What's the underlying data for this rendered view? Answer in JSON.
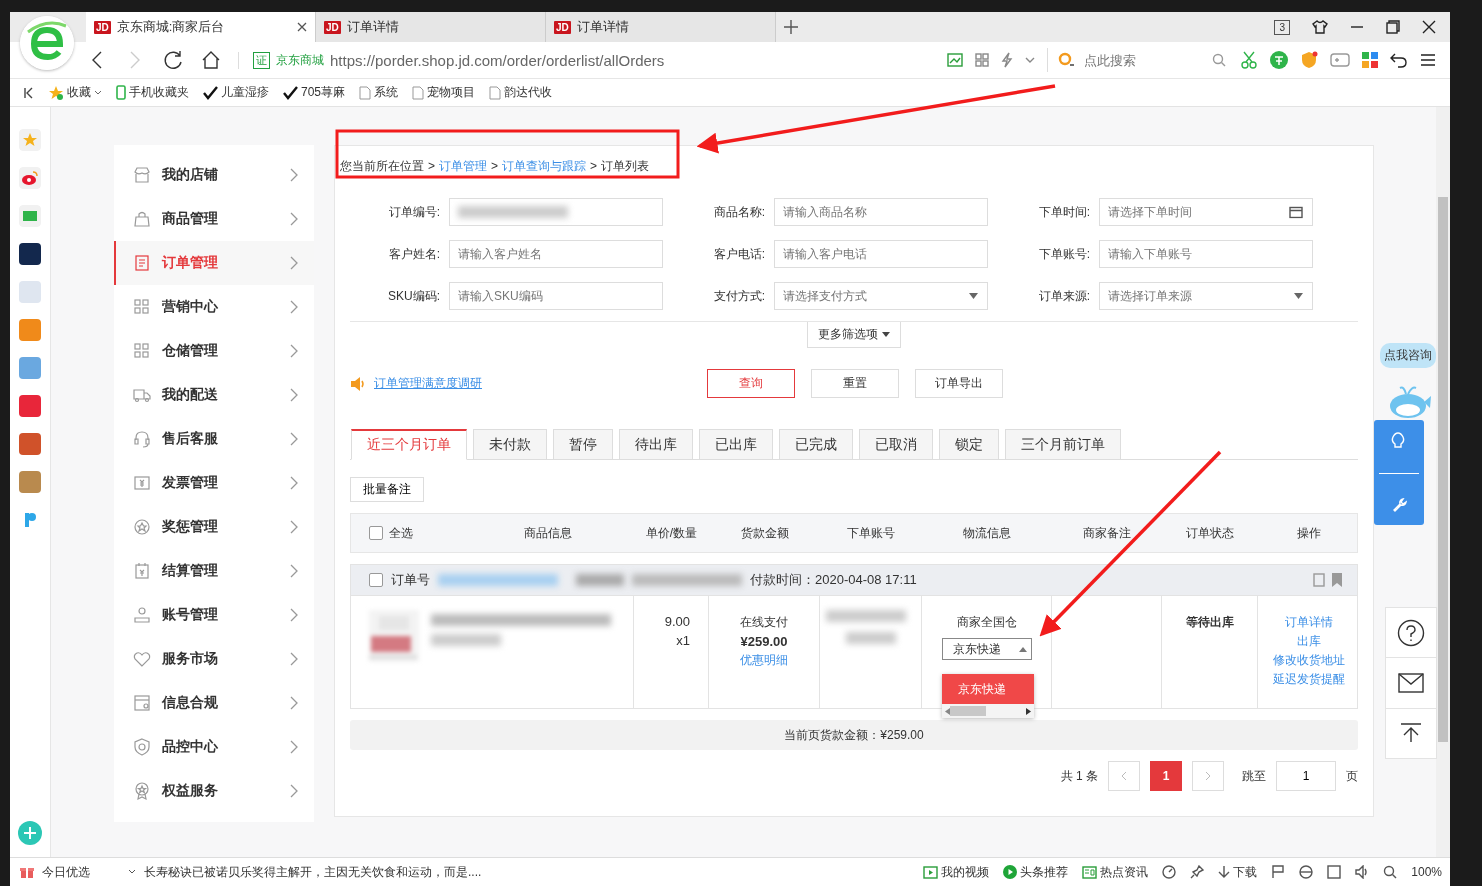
{
  "browser": {
    "tabs": [
      {
        "badge": "JD",
        "title": "京东商城:商家后台",
        "selected": true
      },
      {
        "badge": "JD",
        "title": "订单详情",
        "selected": false
      },
      {
        "badge": "JD",
        "title": "订单详情",
        "selected": false
      }
    ],
    "tab_count": "3",
    "cert_badge": "证",
    "site_name": "京东商城",
    "url_host": "https://porder.shop.jd.com",
    "url_path": "/order/orderlist/allOrders",
    "search_placeholder": "点此搜索",
    "bookmarks": [
      {
        "kind": "star",
        "label": "收藏"
      },
      {
        "kind": "phone",
        "label": "手机收藏夹"
      },
      {
        "kind": "check",
        "label": "儿童湿疹"
      },
      {
        "kind": "check",
        "label": "705荨麻"
      },
      {
        "kind": "page",
        "label": "系统"
      },
      {
        "kind": "page",
        "label": "宠物项目"
      },
      {
        "kind": "page",
        "label": "韵达代收"
      }
    ]
  },
  "sidebar_menu": [
    {
      "label": "我的店铺",
      "selected": false
    },
    {
      "label": "商品管理",
      "selected": false
    },
    {
      "label": "订单管理",
      "selected": true
    },
    {
      "label": "营销中心",
      "selected": false
    },
    {
      "label": "仓储管理",
      "selected": false
    },
    {
      "label": "我的配送",
      "selected": false
    },
    {
      "label": "售后客服",
      "selected": false
    },
    {
      "label": "发票管理",
      "selected": false
    },
    {
      "label": "奖惩管理",
      "selected": false
    },
    {
      "label": "结算管理",
      "selected": false
    },
    {
      "label": "账号管理",
      "selected": false
    },
    {
      "label": "服务市场",
      "selected": false
    },
    {
      "label": "信息合规",
      "selected": false
    },
    {
      "label": "品控中心",
      "selected": false
    },
    {
      "label": "权益服务",
      "selected": false
    }
  ],
  "breadcrumb": [
    {
      "label": "您当前所在位置",
      "link": false
    },
    {
      "separator": ">",
      "label": "订单管理",
      "link": true
    },
    {
      "separator": ">",
      "label": "订单查询与跟踪",
      "link": true
    },
    {
      "separator": ">",
      "label": "订单列表",
      "link": false
    }
  ],
  "filters": [
    {
      "label": "订单编号:",
      "kind": "redacted"
    },
    {
      "label": "商品名称:",
      "kind": "text",
      "placeholder": "请输入商品名称"
    },
    {
      "label": "下单时间:",
      "kind": "date",
      "placeholder": "请选择下单时间"
    },
    {
      "label": "客户姓名:",
      "kind": "text",
      "placeholder": "请输入客户姓名"
    },
    {
      "label": "客户电话:",
      "kind": "text",
      "placeholder": "请输入客户电话"
    },
    {
      "label": "下单账号:",
      "kind": "text",
      "placeholder": "请输入下单账号"
    },
    {
      "label": "SKU编码:",
      "kind": "text",
      "placeholder": "请输入SKU编码"
    },
    {
      "label": "支付方式:",
      "kind": "select",
      "placeholder": "请选择支付方式"
    },
    {
      "label": "订单来源:",
      "kind": "select",
      "placeholder": "请选择订单来源"
    }
  ],
  "more_filters": "更多筛选项",
  "survey_link": "订单管理满意度调研",
  "actions": [
    {
      "label": "查询",
      "kind": "primary"
    },
    {
      "label": "重置",
      "kind": "default"
    },
    {
      "label": "订单导出",
      "kind": "default"
    }
  ],
  "status_tabs": [
    {
      "label": "近三个月订单",
      "selected": true
    },
    {
      "label": "未付款",
      "selected": false
    },
    {
      "label": "暂停",
      "selected": false
    },
    {
      "label": "待出库",
      "selected": false
    },
    {
      "label": "已出库",
      "selected": false
    },
    {
      "label": "已完成",
      "selected": false
    },
    {
      "label": "已取消",
      "selected": false
    },
    {
      "label": "锁定",
      "selected": false
    },
    {
      "label": "三个月前订单",
      "selected": false
    }
  ],
  "batch_note": "批量备注",
  "table": {
    "select_all": {
      "label": "全选",
      "checked": false
    },
    "columns": [
      "商品信息",
      "单价/数量",
      "货款金额",
      "下单账号",
      "物流信息",
      "商家备注",
      "订单状态",
      "操作"
    ]
  },
  "order": {
    "checked": false,
    "number_label": "订单号",
    "payment_time": "付款时间：2020-04-08 17:11",
    "price": "9.00",
    "quantity": "x1",
    "payment_method": "在线支付",
    "amount": "¥259.00",
    "discount_link": "优惠明细",
    "warehouse": "商家全国仓",
    "carrier": "京东快递",
    "carrier_options": [
      {
        "label": "京东快递",
        "selected": true
      }
    ],
    "status": "等待出库",
    "operations": [
      "订单详情",
      "出库",
      "修改收货地址",
      "延迟发货提醒"
    ]
  },
  "summary": "当前页货款金额：¥259.00",
  "pagination": {
    "total": "共 1 条",
    "pages": [
      {
        "label": "1",
        "selected": true
      }
    ],
    "jump_label": "跳至",
    "jump_value": "1",
    "page_suffix": "页"
  },
  "consult_bubble": "点我咨询",
  "status_bar": {
    "left": "今日优选",
    "news": "长寿秘诀已被诺贝乐奖得主解开，主因无关饮食和运动，而是....",
    "items": [
      {
        "kind": "video",
        "label": "我的视频"
      },
      {
        "kind": "play",
        "label": "头条推荐"
      },
      {
        "kind": "news",
        "label": "热点资讯"
      }
    ],
    "download": "下载",
    "zoom": "100%"
  }
}
